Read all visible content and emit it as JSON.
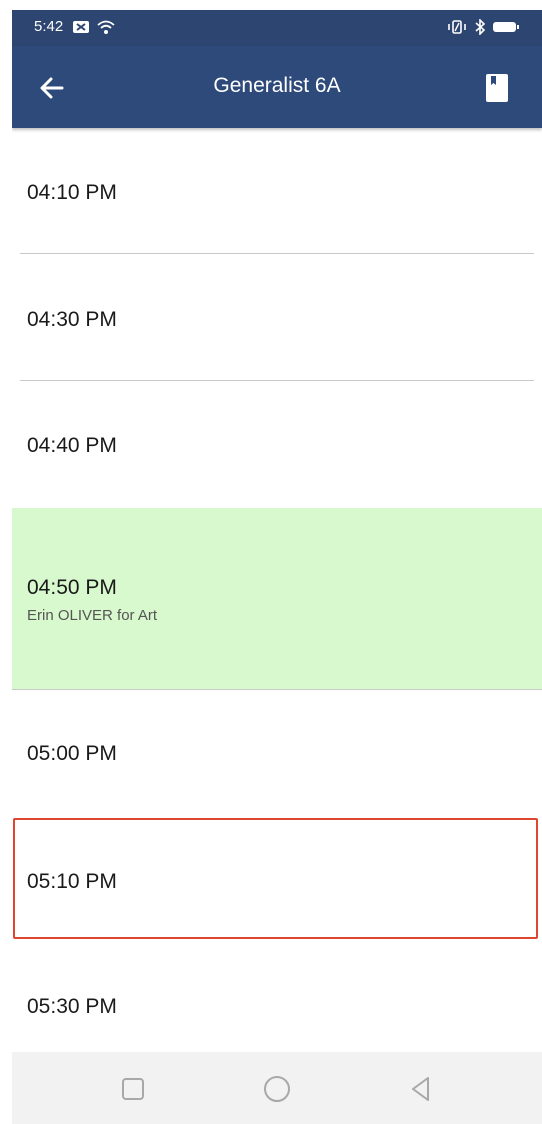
{
  "status_bar": {
    "time": "5:42",
    "icons": [
      "message-icon",
      "wifi-icon",
      "vibrate-icon",
      "bluetooth-icon",
      "battery-icon"
    ]
  },
  "app_bar": {
    "title": "Generalist 6A",
    "back_icon": "arrow-left-icon",
    "action_icon": "book-icon"
  },
  "slots": [
    {
      "time": "04:10 PM",
      "detail": ""
    },
    {
      "time": "04:30 PM",
      "detail": ""
    },
    {
      "time": "04:40 PM",
      "detail": ""
    },
    {
      "time": "04:50 PM",
      "detail": "Erin OLIVER for Art",
      "status": "booked"
    },
    {
      "time": "05:00 PM",
      "detail": ""
    },
    {
      "time": "05:10 PM",
      "detail": "",
      "status": "highlighted"
    },
    {
      "time": "05:30 PM",
      "detail": ""
    }
  ],
  "colors": {
    "status_bar": "#2d4571",
    "app_bar": "#2d4a7a",
    "booked_bg": "#d8f9cd",
    "highlight_border": "#e0452f",
    "nav_bar": "#f2f2f2"
  },
  "nav_bar": {
    "icons": [
      "recent-apps-icon",
      "home-icon",
      "back-icon"
    ]
  }
}
